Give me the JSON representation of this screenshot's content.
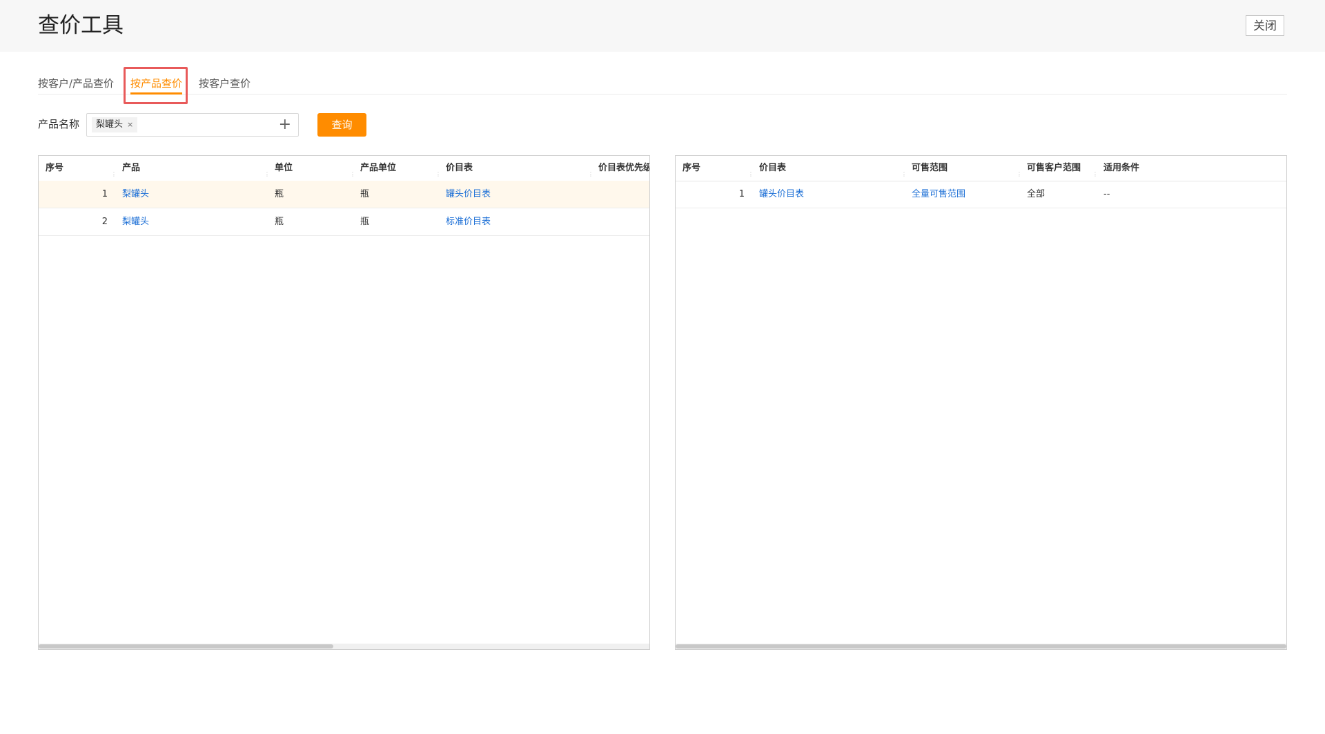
{
  "window": {
    "title": "查价工具",
    "close_label": "关闭"
  },
  "tabs": [
    {
      "label": "按客户/产品查价",
      "active": false
    },
    {
      "label": "按产品查价",
      "active": true
    },
    {
      "label": "按客户查价",
      "active": false
    }
  ],
  "filter": {
    "label": "产品名称",
    "tags": [
      "梨罐头"
    ],
    "tag_remove_glyph": "×",
    "add_glyph": "+",
    "query_label": "查询"
  },
  "left_table": {
    "headers": [
      "序号",
      "产品",
      "单位",
      "产品单位",
      "价目表",
      "价目表优先级"
    ],
    "rows": [
      {
        "index": "1",
        "product": "梨罐头",
        "unit": "瓶",
        "product_unit": "瓶",
        "price_list": "罐头价目表",
        "selected": true
      },
      {
        "index": "2",
        "product": "梨罐头",
        "unit": "瓶",
        "product_unit": "瓶",
        "price_list": "标准价目表",
        "selected": false
      }
    ]
  },
  "right_table": {
    "headers": [
      "序号",
      "价目表",
      "可售范围",
      "可售客户范围",
      "适用条件"
    ],
    "rows": [
      {
        "index": "1",
        "price_list": "罐头价目表",
        "sale_scope": "全量可售范围",
        "customer_scope": "全部",
        "condition": "--"
      }
    ]
  },
  "colors": {
    "accent": "#ff8c00",
    "link": "#1c6fd6",
    "highlight_box": "#e85a5a",
    "selected_row": "#fff8ec"
  }
}
